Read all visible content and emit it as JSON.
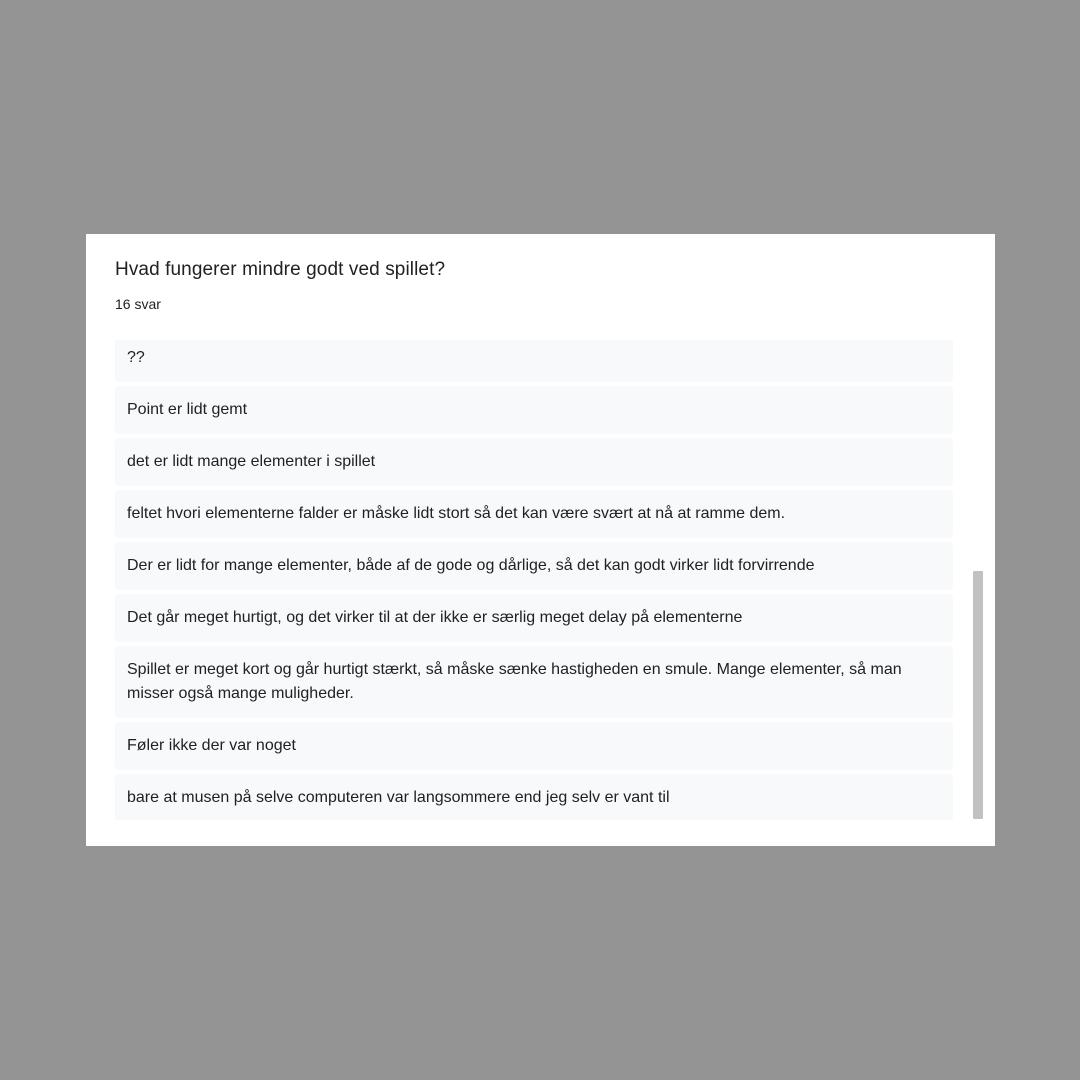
{
  "question": {
    "title": "Hvad fungerer mindre godt ved spillet?",
    "count_label": "16 svar"
  },
  "responses": [
    "??",
    "Point er lidt gemt",
    "det er lidt mange elementer i spillet",
    "feltet hvori elementerne falder er måske lidt stort så det kan være svært at nå at ramme dem.",
    "Der er lidt for mange elementer, både af de gode og dårlige, så det kan godt virker lidt forvirrende",
    "Det går meget hurtigt, og det virker til at der ikke er særlig meget delay på elementerne",
    "Spillet er meget kort og går hurtigt stærkt, så måske sænke hastigheden en smule. Mange elementer, så man misser også mange muligheder.",
    "Føler ikke der var noget",
    "bare at musen på selve computeren var langsommere end jeg selv er vant til"
  ]
}
